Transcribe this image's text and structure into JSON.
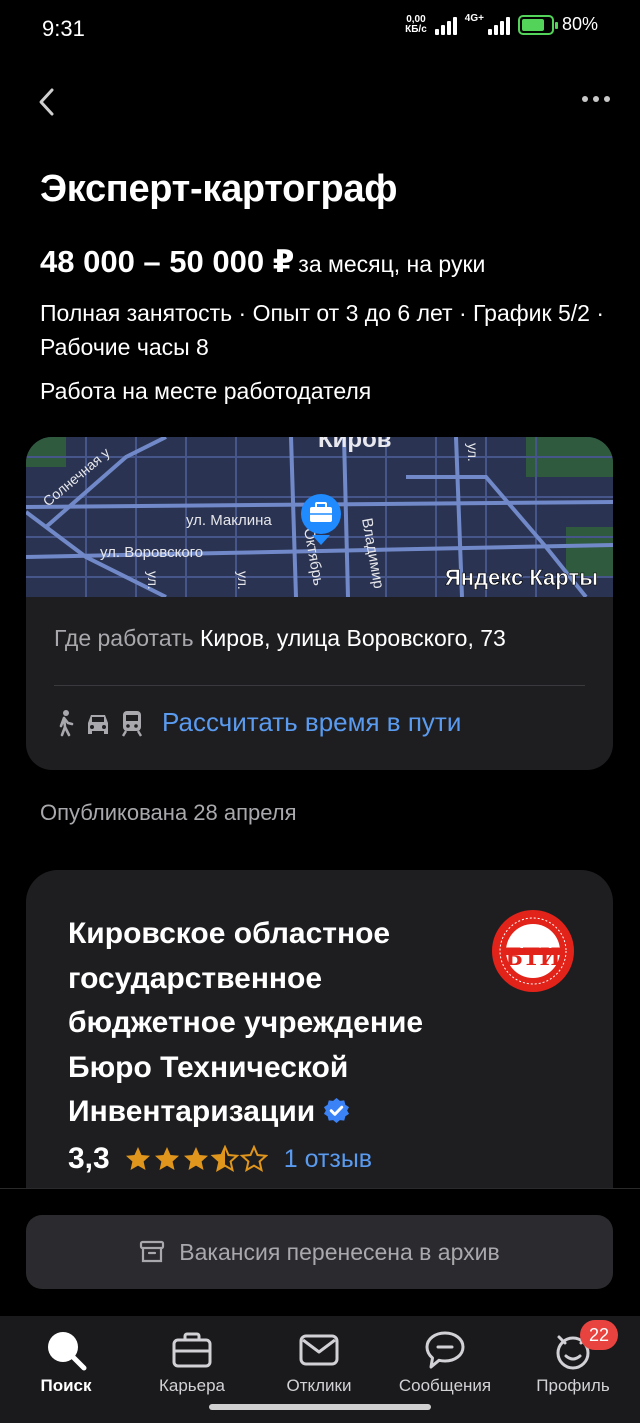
{
  "status": {
    "time": "9:31",
    "net_speed_value": "0,00",
    "net_speed_unit": "КБ/с",
    "network": "4G+",
    "battery": "80%"
  },
  "vacancy": {
    "title": "Эксперт-картограф",
    "salary": "48 000 – 50 000 ₽",
    "salary_suffix": "за месяц, на руки",
    "conditions": "Полная занятость · Опыт от 3 до 6 лет · График 5/2 · Рабочие часы 8",
    "workplace": "Работа на месте работодателя",
    "published": "Опубликована 28 апреля"
  },
  "map": {
    "city_label": "Киров",
    "provider": "Яндекс Карты",
    "streets": [
      "Солнечная у",
      "ул. Маклина",
      "ул. Воровского",
      "Октябрь",
      "Владимир",
      "ул.",
      "ул.",
      "ул."
    ],
    "address_label": "Где работать",
    "address": "Киров, улица Воровского, 73",
    "route_link": "Рассчитать время в пути"
  },
  "company": {
    "name": "Кировское областное государственное бюджетное учреждение Бюро Технической Инвентаризации",
    "logo_text": "БТИ",
    "rating_value": "3,3",
    "rating": 3.3,
    "reviews": "1 отзыв"
  },
  "archive": {
    "label": "Вакансия перенесена в архив"
  },
  "tabs": [
    {
      "label": "Поиск",
      "icon": "search-icon",
      "active": true
    },
    {
      "label": "Карьера",
      "icon": "briefcase-icon"
    },
    {
      "label": "Отклики",
      "icon": "envelope-icon"
    },
    {
      "label": "Сообщения",
      "icon": "chat-icon"
    },
    {
      "label": "Профиль",
      "icon": "profile-icon",
      "badge": "22"
    }
  ],
  "colors": {
    "accent_link": "#5a9bf0",
    "map_pin": "#1f8bff",
    "logo_red": "#e2231a",
    "badge_red": "#e8433f",
    "star": "#e0951c"
  }
}
